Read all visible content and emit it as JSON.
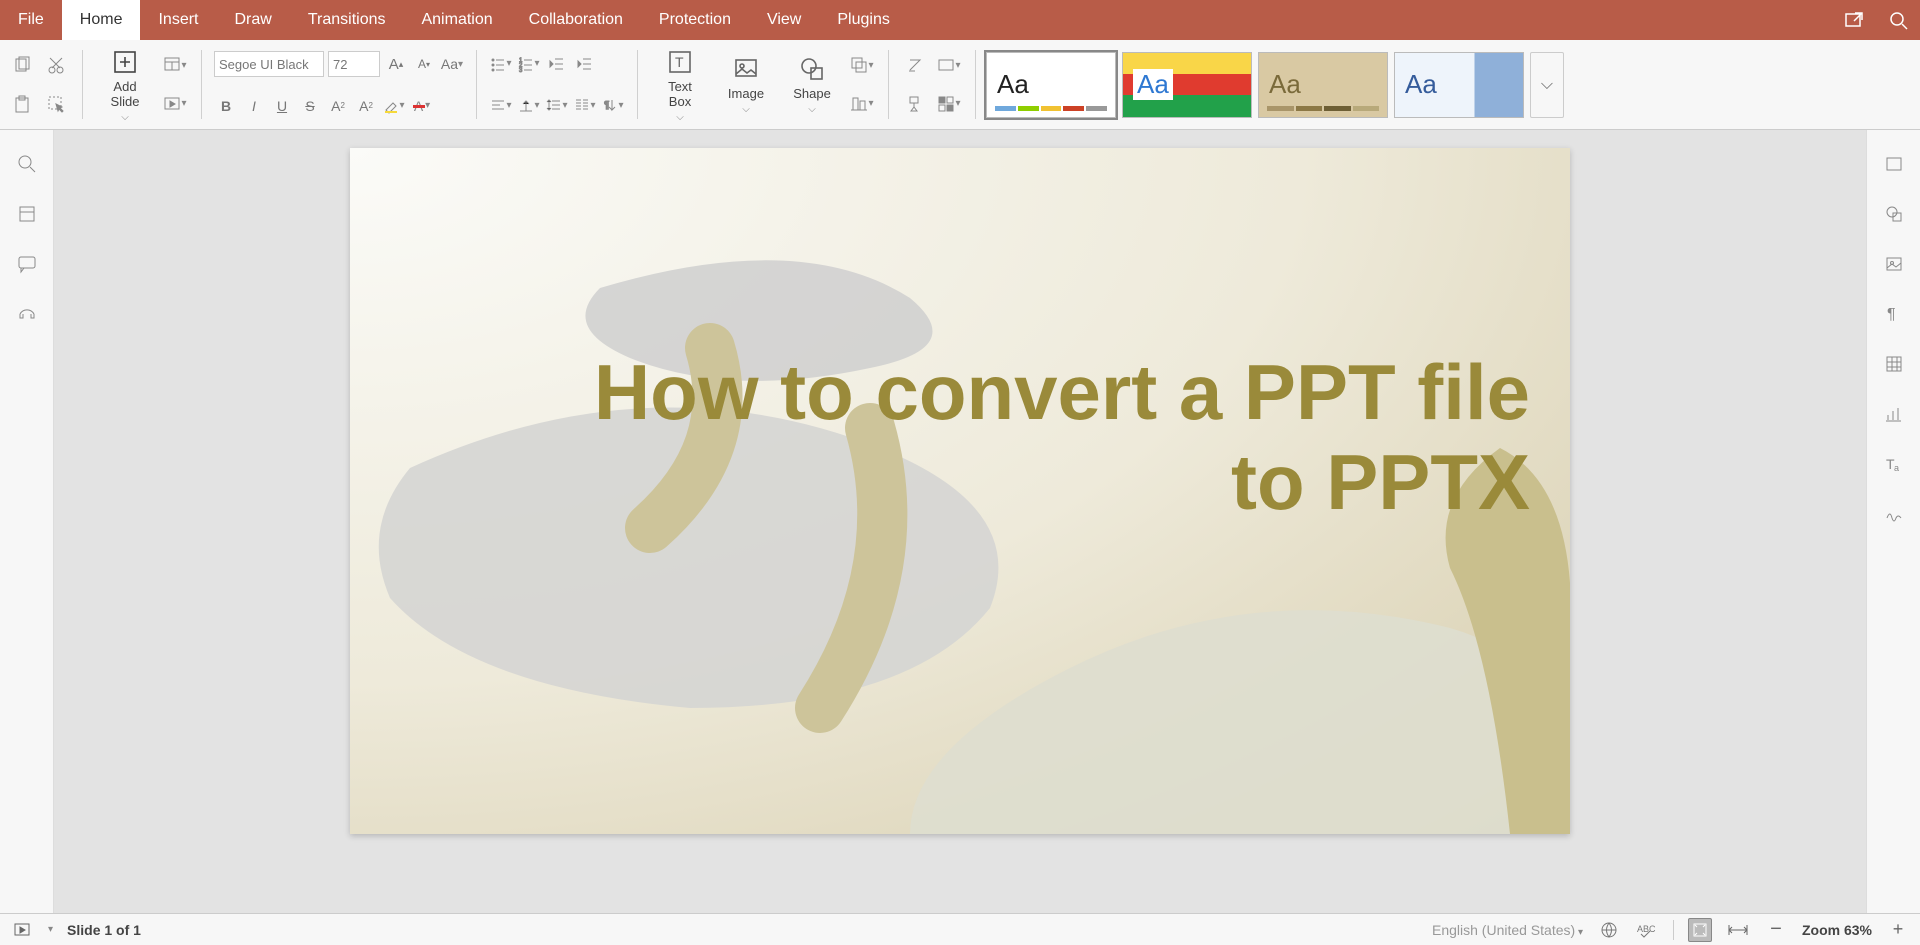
{
  "menu": {
    "tabs": [
      "File",
      "Home",
      "Insert",
      "Draw",
      "Transitions",
      "Animation",
      "Collaboration",
      "Protection",
      "View",
      "Plugins"
    ],
    "active": "Home"
  },
  "ribbon": {
    "add_slide": "Add\nSlide",
    "font_name": "Segoe UI Black",
    "font_size": "72",
    "text_box": "Text\nBox",
    "image": "Image",
    "shape": "Shape"
  },
  "themes": [
    {
      "label": "Aa",
      "bg": "#ffffff",
      "fg": "#222222",
      "strip": [
        "#6fa8dc",
        "#8fce00",
        "#f1c232",
        "#cc4125",
        "#999"
      ]
    },
    {
      "label": "Aa",
      "bg": "#ffffff",
      "fg": "#2e78d2",
      "strip": [
        "#2e78d2",
        "#e03b2f",
        "#22a14a",
        "#f6c02e",
        "#7a3fb5"
      ]
    },
    {
      "label": "Aa",
      "bg": "#d9c9a3",
      "fg": "#7a6a3a",
      "strip": [
        "#a99569",
        "#8c7845",
        "#6e5f35",
        "#b8a97a",
        "#cfc3a0"
      ]
    },
    {
      "label": "Aa",
      "bg": "linear-gradient(90deg,#eef4fb 60%,#8fb0d9 60%)",
      "fg": "#355c9b",
      "strip": [
        "#355c9b",
        "#7aa6d9",
        "#b7cce8",
        "#d7e3f2",
        "#e9f0f8"
      ]
    }
  ],
  "slide": {
    "title": "How to convert a PPT file to PPTX"
  },
  "status": {
    "slide_info": "Slide 1 of 1",
    "language": "English (United States)",
    "zoom": "Zoom 63%"
  }
}
